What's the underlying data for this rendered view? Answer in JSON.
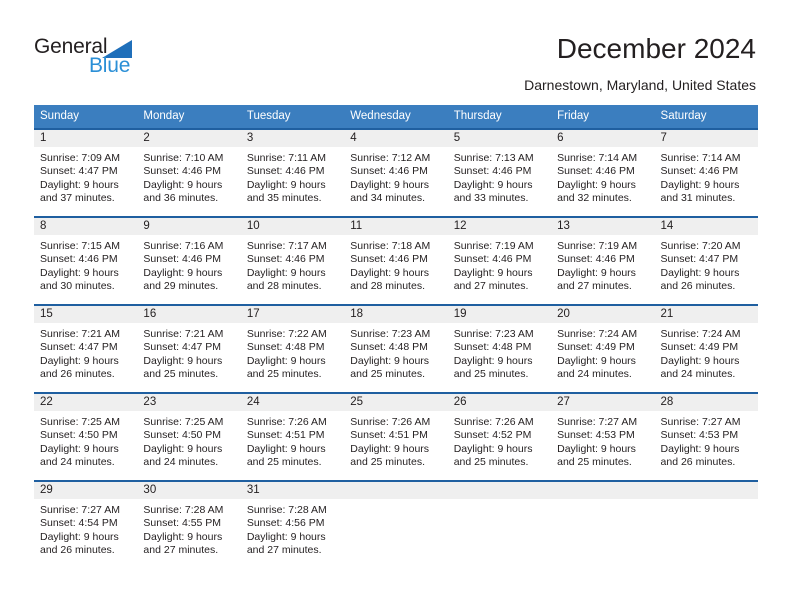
{
  "brand": {
    "name_part1": "General",
    "name_part2": "Blue",
    "triangle_color": "#1f6fba",
    "blue_color": "#2b8fd6"
  },
  "header": {
    "title": "December 2024",
    "location": "Darnestown, Maryland, United States"
  },
  "theme": {
    "header_bg": "#3b7ebf",
    "row_rule": "#1f5fa0",
    "daynum_band": "#efefef",
    "text": "#231f20"
  },
  "weekdays": [
    "Sunday",
    "Monday",
    "Tuesday",
    "Wednesday",
    "Thursday",
    "Friday",
    "Saturday"
  ],
  "labels": {
    "sunrise_prefix": "Sunrise:",
    "sunset_prefix": "Sunset:",
    "daylight_prefix": "Daylight:"
  },
  "weeks": [
    [
      {
        "day": "1",
        "sunrise": "Sunrise: 7:09 AM",
        "sunset": "Sunset: 4:47 PM",
        "daylight1": "Daylight: 9 hours",
        "daylight2": "and 37 minutes."
      },
      {
        "day": "2",
        "sunrise": "Sunrise: 7:10 AM",
        "sunset": "Sunset: 4:46 PM",
        "daylight1": "Daylight: 9 hours",
        "daylight2": "and 36 minutes."
      },
      {
        "day": "3",
        "sunrise": "Sunrise: 7:11 AM",
        "sunset": "Sunset: 4:46 PM",
        "daylight1": "Daylight: 9 hours",
        "daylight2": "and 35 minutes."
      },
      {
        "day": "4",
        "sunrise": "Sunrise: 7:12 AM",
        "sunset": "Sunset: 4:46 PM",
        "daylight1": "Daylight: 9 hours",
        "daylight2": "and 34 minutes."
      },
      {
        "day": "5",
        "sunrise": "Sunrise: 7:13 AM",
        "sunset": "Sunset: 4:46 PM",
        "daylight1": "Daylight: 9 hours",
        "daylight2": "and 33 minutes."
      },
      {
        "day": "6",
        "sunrise": "Sunrise: 7:14 AM",
        "sunset": "Sunset: 4:46 PM",
        "daylight1": "Daylight: 9 hours",
        "daylight2": "and 32 minutes."
      },
      {
        "day": "7",
        "sunrise": "Sunrise: 7:14 AM",
        "sunset": "Sunset: 4:46 PM",
        "daylight1": "Daylight: 9 hours",
        "daylight2": "and 31 minutes."
      }
    ],
    [
      {
        "day": "8",
        "sunrise": "Sunrise: 7:15 AM",
        "sunset": "Sunset: 4:46 PM",
        "daylight1": "Daylight: 9 hours",
        "daylight2": "and 30 minutes."
      },
      {
        "day": "9",
        "sunrise": "Sunrise: 7:16 AM",
        "sunset": "Sunset: 4:46 PM",
        "daylight1": "Daylight: 9 hours",
        "daylight2": "and 29 minutes."
      },
      {
        "day": "10",
        "sunrise": "Sunrise: 7:17 AM",
        "sunset": "Sunset: 4:46 PM",
        "daylight1": "Daylight: 9 hours",
        "daylight2": "and 28 minutes."
      },
      {
        "day": "11",
        "sunrise": "Sunrise: 7:18 AM",
        "sunset": "Sunset: 4:46 PM",
        "daylight1": "Daylight: 9 hours",
        "daylight2": "and 28 minutes."
      },
      {
        "day": "12",
        "sunrise": "Sunrise: 7:19 AM",
        "sunset": "Sunset: 4:46 PM",
        "daylight1": "Daylight: 9 hours",
        "daylight2": "and 27 minutes."
      },
      {
        "day": "13",
        "sunrise": "Sunrise: 7:19 AM",
        "sunset": "Sunset: 4:46 PM",
        "daylight1": "Daylight: 9 hours",
        "daylight2": "and 27 minutes."
      },
      {
        "day": "14",
        "sunrise": "Sunrise: 7:20 AM",
        "sunset": "Sunset: 4:47 PM",
        "daylight1": "Daylight: 9 hours",
        "daylight2": "and 26 minutes."
      }
    ],
    [
      {
        "day": "15",
        "sunrise": "Sunrise: 7:21 AM",
        "sunset": "Sunset: 4:47 PM",
        "daylight1": "Daylight: 9 hours",
        "daylight2": "and 26 minutes."
      },
      {
        "day": "16",
        "sunrise": "Sunrise: 7:21 AM",
        "sunset": "Sunset: 4:47 PM",
        "daylight1": "Daylight: 9 hours",
        "daylight2": "and 25 minutes."
      },
      {
        "day": "17",
        "sunrise": "Sunrise: 7:22 AM",
        "sunset": "Sunset: 4:48 PM",
        "daylight1": "Daylight: 9 hours",
        "daylight2": "and 25 minutes."
      },
      {
        "day": "18",
        "sunrise": "Sunrise: 7:23 AM",
        "sunset": "Sunset: 4:48 PM",
        "daylight1": "Daylight: 9 hours",
        "daylight2": "and 25 minutes."
      },
      {
        "day": "19",
        "sunrise": "Sunrise: 7:23 AM",
        "sunset": "Sunset: 4:48 PM",
        "daylight1": "Daylight: 9 hours",
        "daylight2": "and 25 minutes."
      },
      {
        "day": "20",
        "sunrise": "Sunrise: 7:24 AM",
        "sunset": "Sunset: 4:49 PM",
        "daylight1": "Daylight: 9 hours",
        "daylight2": "and 24 minutes."
      },
      {
        "day": "21",
        "sunrise": "Sunrise: 7:24 AM",
        "sunset": "Sunset: 4:49 PM",
        "daylight1": "Daylight: 9 hours",
        "daylight2": "and 24 minutes."
      }
    ],
    [
      {
        "day": "22",
        "sunrise": "Sunrise: 7:25 AM",
        "sunset": "Sunset: 4:50 PM",
        "daylight1": "Daylight: 9 hours",
        "daylight2": "and 24 minutes."
      },
      {
        "day": "23",
        "sunrise": "Sunrise: 7:25 AM",
        "sunset": "Sunset: 4:50 PM",
        "daylight1": "Daylight: 9 hours",
        "daylight2": "and 24 minutes."
      },
      {
        "day": "24",
        "sunrise": "Sunrise: 7:26 AM",
        "sunset": "Sunset: 4:51 PM",
        "daylight1": "Daylight: 9 hours",
        "daylight2": "and 25 minutes."
      },
      {
        "day": "25",
        "sunrise": "Sunrise: 7:26 AM",
        "sunset": "Sunset: 4:51 PM",
        "daylight1": "Daylight: 9 hours",
        "daylight2": "and 25 minutes."
      },
      {
        "day": "26",
        "sunrise": "Sunrise: 7:26 AM",
        "sunset": "Sunset: 4:52 PM",
        "daylight1": "Daylight: 9 hours",
        "daylight2": "and 25 minutes."
      },
      {
        "day": "27",
        "sunrise": "Sunrise: 7:27 AM",
        "sunset": "Sunset: 4:53 PM",
        "daylight1": "Daylight: 9 hours",
        "daylight2": "and 25 minutes."
      },
      {
        "day": "28",
        "sunrise": "Sunrise: 7:27 AM",
        "sunset": "Sunset: 4:53 PM",
        "daylight1": "Daylight: 9 hours",
        "daylight2": "and 26 minutes."
      }
    ],
    [
      {
        "day": "29",
        "sunrise": "Sunrise: 7:27 AM",
        "sunset": "Sunset: 4:54 PM",
        "daylight1": "Daylight: 9 hours",
        "daylight2": "and 26 minutes."
      },
      {
        "day": "30",
        "sunrise": "Sunrise: 7:28 AM",
        "sunset": "Sunset: 4:55 PM",
        "daylight1": "Daylight: 9 hours",
        "daylight2": "and 27 minutes."
      },
      {
        "day": "31",
        "sunrise": "Sunrise: 7:28 AM",
        "sunset": "Sunset: 4:56 PM",
        "daylight1": "Daylight: 9 hours",
        "daylight2": "and 27 minutes."
      },
      {
        "day": "",
        "sunrise": "",
        "sunset": "",
        "daylight1": "",
        "daylight2": ""
      },
      {
        "day": "",
        "sunrise": "",
        "sunset": "",
        "daylight1": "",
        "daylight2": ""
      },
      {
        "day": "",
        "sunrise": "",
        "sunset": "",
        "daylight1": "",
        "daylight2": ""
      },
      {
        "day": "",
        "sunrise": "",
        "sunset": "",
        "daylight1": "",
        "daylight2": ""
      }
    ]
  ]
}
